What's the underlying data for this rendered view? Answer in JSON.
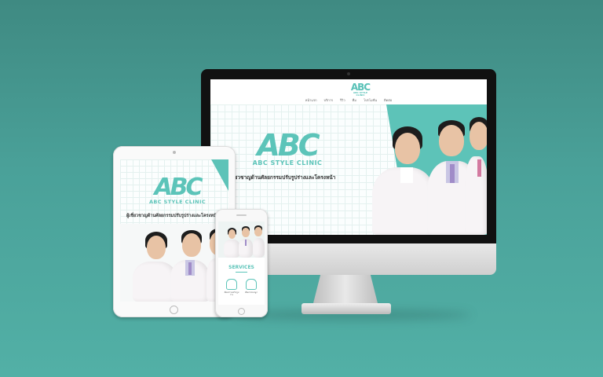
{
  "brand": {
    "logo_letters": "ABC",
    "name": "ABC STYLE CLINIC",
    "tagline": "ผู้เชี่ยวชาญด้านศัลยกรรมปรับรูปร่างและโครงหน้า"
  },
  "desktop": {
    "nav": [
      "หน้าแรก",
      "บริการ",
      "รีวิว",
      "ทีม",
      "โปรโมชั่น",
      "ติดต่อ"
    ],
    "hero_tagline": "ชวชาญด้านศัลยกรรมปรับรูปร่างและโครงหน้า"
  },
  "tablet": {
    "tagline": "ผู้เชี่ยวชาญด้านศัลยกรรมปรับรูปร่างและโครงหน้า"
  },
  "phone": {
    "section_title": "SERVICES",
    "services": [
      {
        "label": "ศัลยกรรมปรับรูปร่าง",
        "icon": "body-icon"
      },
      {
        "label": "ศัลยกรรมจมูก",
        "icon": "nose-icon"
      }
    ]
  },
  "colors": {
    "background": "#4aa199",
    "brand_teal": "#5cc4b9"
  }
}
